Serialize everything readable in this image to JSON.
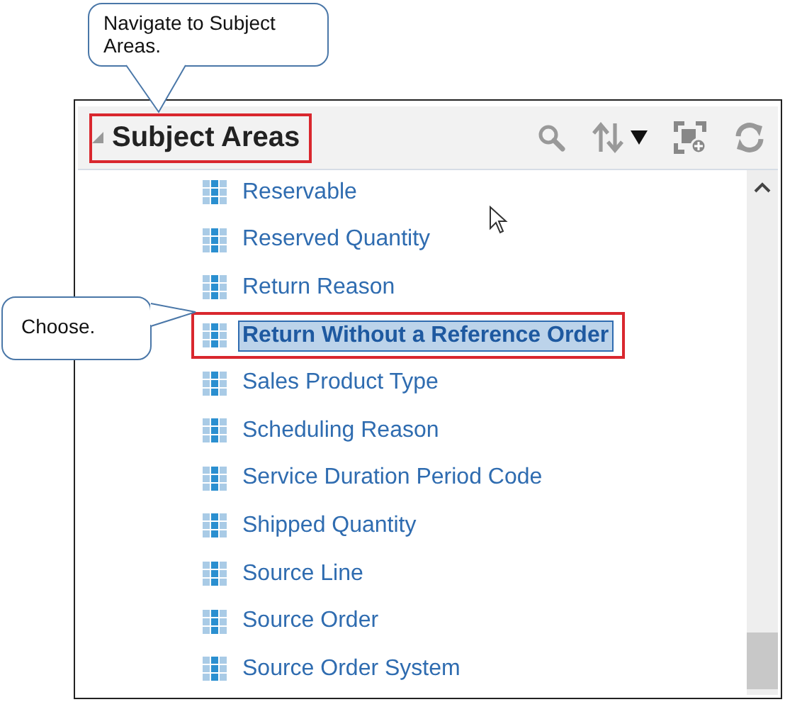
{
  "callouts": [
    {
      "kind": "top",
      "text": "Navigate  to Subject Areas."
    },
    {
      "kind": "left",
      "text": "Choose."
    }
  ],
  "panel": {
    "title": "Subject Areas",
    "title_annotated": true,
    "collapsed": false,
    "items": [
      {
        "label": "Reservable",
        "selected": false,
        "annotated": false
      },
      {
        "label": "Reserved Quantity",
        "selected": false,
        "annotated": false
      },
      {
        "label": "Return Reason",
        "selected": false,
        "annotated": false
      },
      {
        "label": "Return Without a Reference Order",
        "selected": true,
        "annotated": true
      },
      {
        "label": "Sales Product Type",
        "selected": false,
        "annotated": false
      },
      {
        "label": "Scheduling Reason",
        "selected": false,
        "annotated": false
      },
      {
        "label": "Service Duration Period Code",
        "selected": false,
        "annotated": false
      },
      {
        "label": "Shipped Quantity",
        "selected": false,
        "annotated": false
      },
      {
        "label": "Source Line",
        "selected": false,
        "annotated": false
      },
      {
        "label": "Source Order",
        "selected": false,
        "annotated": false
      },
      {
        "label": "Source Order System",
        "selected": false,
        "annotated": false
      }
    ]
  }
}
